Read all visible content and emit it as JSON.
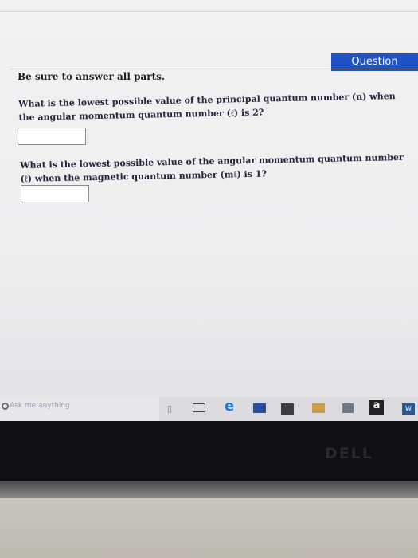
{
  "header": {
    "question_tab": "Question"
  },
  "page": {
    "instruction": "Be sure to answer all parts."
  },
  "questions": [
    {
      "text": "What is the lowest possible value of the principal quantum number (n) when the angular momentum quantum number (ℓ) is 2?",
      "answer": ""
    },
    {
      "text": "What is the lowest possible value of the angular momentum quantum number (ℓ) when the magnetic quantum number (mℓ) is 1?",
      "answer": ""
    }
  ],
  "taskbar": {
    "search_placeholder": "Ask me anything",
    "icons": [
      "microphone-icon",
      "task-view-icon",
      "edge-icon",
      "file-explorer-icon",
      "store-icon",
      "app-icon",
      "app-icon",
      "amazon-icon",
      "word-icon"
    ],
    "amazon_label": "a",
    "edge_label": "e",
    "word_label": "W"
  },
  "device": {
    "brand": "DELL"
  },
  "colors": {
    "question_tab": "#1f52c6",
    "edge": "#1e78d7"
  }
}
